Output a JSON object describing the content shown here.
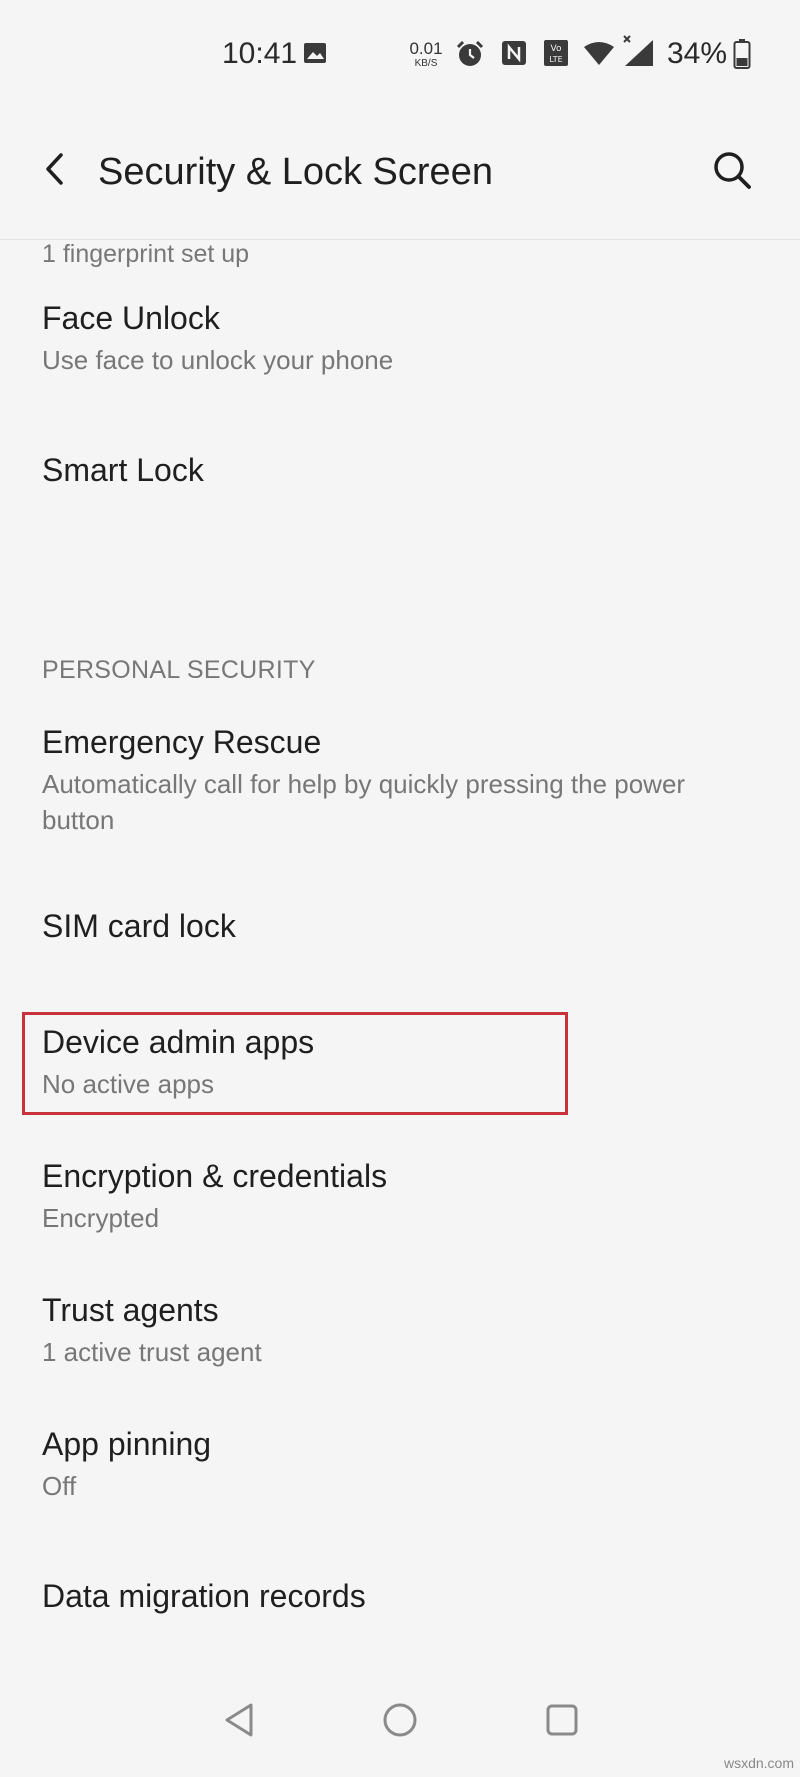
{
  "status_bar": {
    "time": "10:41",
    "net_speed_value": "0.01",
    "net_speed_unit": "KB/S",
    "battery_percent": "34%",
    "icons": [
      "image-icon",
      "alarm-icon",
      "nfc-icon",
      "volte-icon",
      "wifi-icon",
      "cellular-signal-icon",
      "battery-icon"
    ]
  },
  "app_bar": {
    "title": "Security & Lock Screen",
    "back_icon": "back-arrow-icon",
    "search_icon": "search-icon"
  },
  "list": {
    "partial_subtitle": "1 fingerprint set up",
    "items": [
      {
        "title": "Face Unlock",
        "subtitle": "Use face to unlock your phone"
      },
      {
        "title": "Smart Lock",
        "subtitle": ""
      }
    ],
    "section_header": "PERSONAL SECURITY",
    "section_items": [
      {
        "title": "Emergency Rescue",
        "subtitle": "Automatically call for help by quickly pressing the power button"
      },
      {
        "title": "SIM card lock",
        "subtitle": ""
      },
      {
        "title": "Device admin apps",
        "subtitle": "No active apps",
        "highlighted": true
      },
      {
        "title": "Encryption & credentials",
        "subtitle": "Encrypted"
      },
      {
        "title": "Trust agents",
        "subtitle": "1 active trust agent"
      },
      {
        "title": "App pinning",
        "subtitle": "Off"
      },
      {
        "title": "Data migration records",
        "subtitle": ""
      }
    ]
  },
  "colors": {
    "background": "#f5f5f5",
    "highlight": "#c8323a",
    "text_primary": "#1f1f1f",
    "text_secondary": "#777777"
  },
  "watermark": "wsxdn.com"
}
